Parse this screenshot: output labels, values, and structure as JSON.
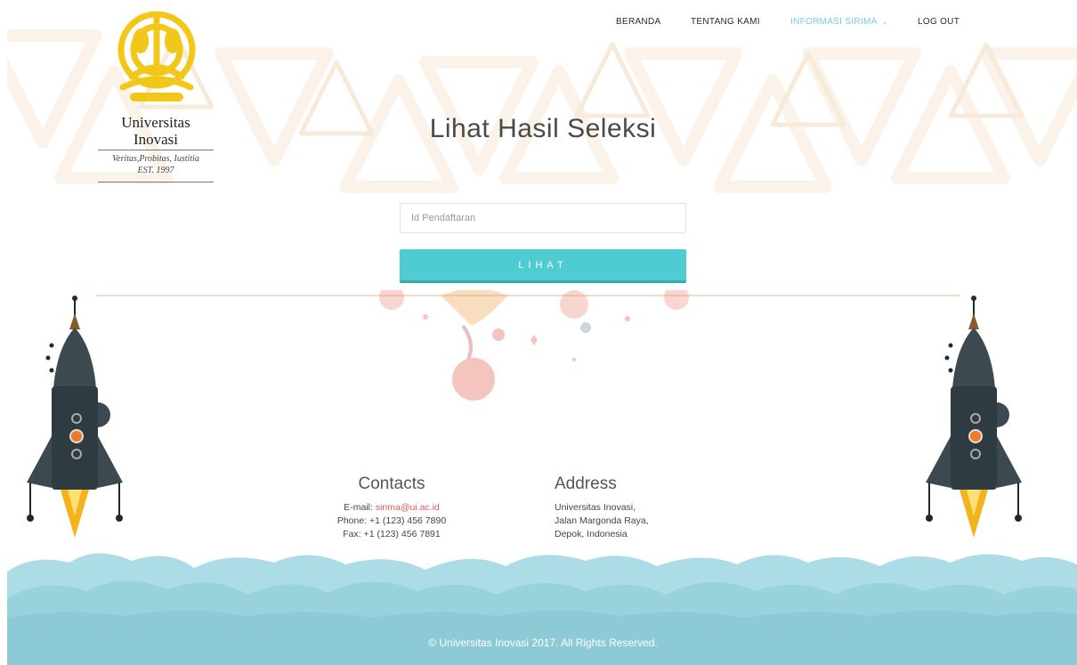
{
  "logo": {
    "name_line1": "Universitas",
    "name_line2": "Inovasi",
    "motto": "Veritas,Probitas, Iustitia",
    "established": "EST. 1997"
  },
  "nav": {
    "items": [
      {
        "label": "BERANDA"
      },
      {
        "label": "TENTANG KAMI"
      },
      {
        "label": "INFORMASI SIRIMA",
        "has_dropdown": true,
        "active": true
      },
      {
        "label": "LOG OUT"
      }
    ]
  },
  "page": {
    "title": "Lihat Hasil Seleksi"
  },
  "form": {
    "id_placeholder": "Id Pendaftaran",
    "id_value": "",
    "submit_label": "LIHAT"
  },
  "footer": {
    "contacts": {
      "heading": "Contacts",
      "email_label": "E-mail: ",
      "email": "sirima@ui.ac.id",
      "phone": "Phone: +1 (123) 456 7890",
      "fax": "Fax: +1 (123) 456 7891"
    },
    "address": {
      "heading": "Address",
      "line1": "Universitas Inovasi,",
      "line2": "Jalan Margonda Raya,",
      "line3": "Depok, Indonesia"
    },
    "copyright": "© Universitas Inovasi 2017. All Rights Reserved."
  },
  "colors": {
    "accent": "#4fccd1",
    "nav_active": "#7cc9e0",
    "link": "#e0585c",
    "cloud_light": "#acdde7",
    "cloud_dark": "#8fcdd8",
    "logo_gold": "#f2c71a"
  }
}
